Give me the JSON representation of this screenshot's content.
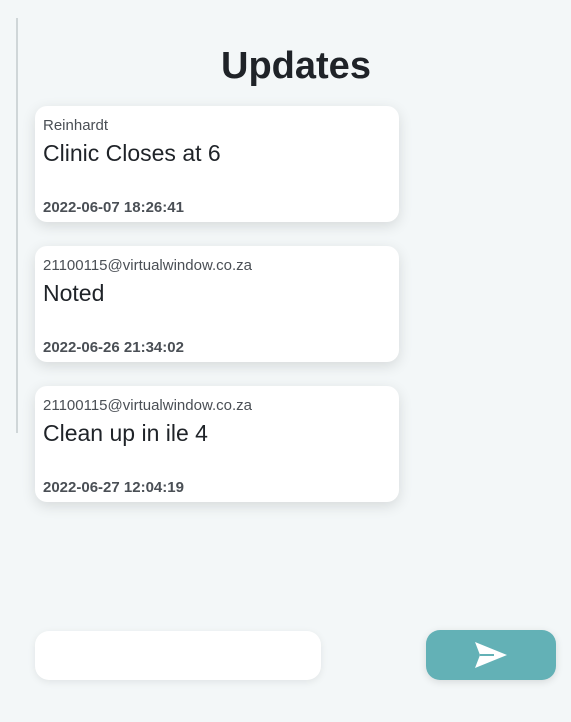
{
  "header": {
    "title": "Updates"
  },
  "feed": {
    "items": [
      {
        "author": "Reinhardt",
        "message": "Clinic Closes at 6",
        "timestamp": "2022-06-07 18:26:41"
      },
      {
        "author": "21100115@virtualwindow.co.za",
        "message": "Noted",
        "timestamp": "2022-06-26 21:34:02"
      },
      {
        "author": "21100115@virtualwindow.co.za",
        "message": "Clean up in ile 4",
        "timestamp": "2022-06-27 12:04:19"
      }
    ]
  },
  "composer": {
    "input_value": "",
    "send_icon": "send-icon"
  },
  "colors": {
    "background": "#f3f7f8",
    "accent": "#63b1b6",
    "card": "#ffffff"
  }
}
